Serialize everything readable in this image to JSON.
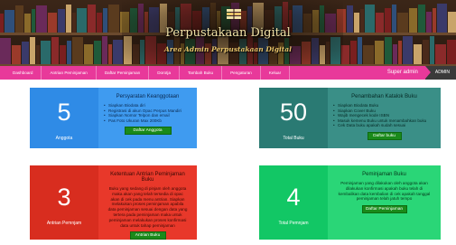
{
  "header": {
    "title": "Perpustakaan Digital",
    "subtitle": "Area Admin Perpustakaan Digital"
  },
  "nav": {
    "items": [
      "Dashboard",
      "Antrian Peminjaman",
      "Daftar Peminjaman",
      "Dorotja",
      "Tambah Buku",
      "Pengaturan",
      "Keluar"
    ],
    "user": "Super admin",
    "role": "ADMIN"
  },
  "cards": {
    "anggota": {
      "number": "5",
      "caption": "Anggota",
      "title": "Persyaratan Keanggotaan",
      "items": [
        "Siapkan Biodata diri",
        "Registrasi di akun Opac Perpus Mandiri",
        "Siapkan Nomor Telpon dan email",
        "Pas Foto Ukuran Max 200Kb"
      ],
      "button": "Daftar Anggota"
    },
    "buku": {
      "number": "50",
      "caption": "Total Buku",
      "title": "Penambahan Katalok Buku",
      "items": [
        "Siapkan Biodata Buku",
        "Siapkan Cover Buku",
        "Wajib mengecek kode ISBN",
        "Masuk kemenu Buku untuk menambahkan buku",
        "Cek Data buku apakah sudah sesuai"
      ],
      "button": "Daftar buku"
    },
    "antrian": {
      "number": "3",
      "caption": "Antrian Pemnjam",
      "title": "Ketentuan Antrian Peminjaman Buku",
      "text": "Buku yang sedang di pinjam oleh anggota maka akan yang telah tersedia di opac akan di cek pada menu antrian. Siapkan melakukan proses peminjaman apabila data peminjaman sesuai dengan data yang tertera pada peminjaman maka untuk peminjaman melakukan proses konfirmasi data untuk tahap peminjaman",
      "button": "Antrian Buku"
    },
    "peminjaman": {
      "number": "4",
      "caption": "Total Pemnjam",
      "title": "Peminjaman Buku",
      "text": "Peminjaman yang dilakukan oleh anggota akan dilakukan konfirmasi apakah buku telah di kembalikan data kembalian di cek apakah tanggal peminjaman telah jatuh tempo",
      "button": "Daftar Peminjaman"
    }
  }
}
